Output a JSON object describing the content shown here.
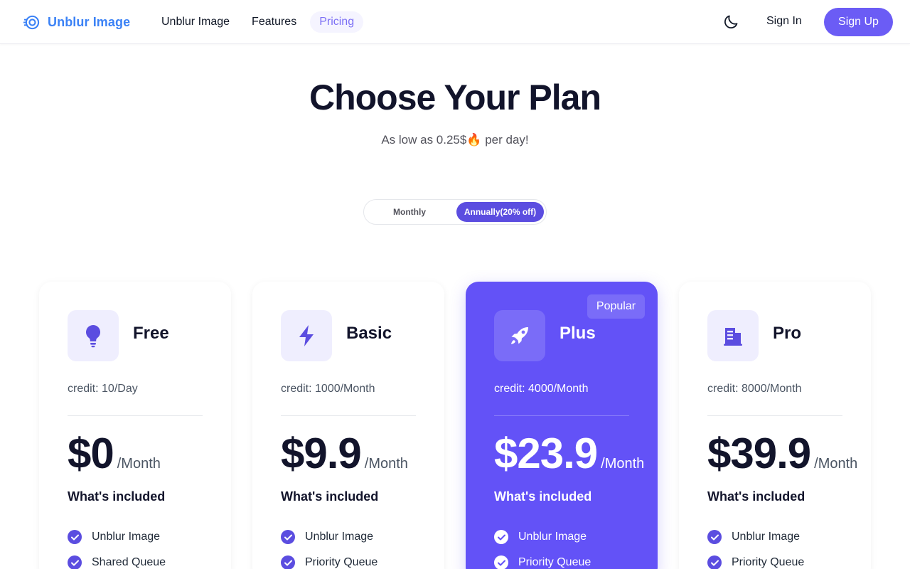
{
  "header": {
    "logo_text": "Unblur Image",
    "nav": [
      {
        "label": "Unblur Image"
      },
      {
        "label": "Features"
      },
      {
        "label": "Pricing",
        "active": true
      }
    ],
    "theme_icon": "moon-icon",
    "signin_label": "Sign In",
    "signup_label": "Sign Up"
  },
  "hero": {
    "title": "Choose Your Plan",
    "subtitle": "As low as 0.25$🔥 per day!"
  },
  "billing_toggle": {
    "monthly_label": "Monthly",
    "annual_label": "Annually(20% off)",
    "selected": "annual"
  },
  "plans": [
    {
      "name": "Free",
      "icon": "lightbulb-icon",
      "credit": "credit: 10/Day",
      "price": "$0",
      "period": "/Month",
      "included_label": "What's included",
      "features": [
        "Unblur Image",
        "Shared Queue"
      ]
    },
    {
      "name": "Basic",
      "icon": "lightning-icon",
      "credit": "credit: 1000/Month",
      "price": "$9.9",
      "period": "/Month",
      "included_label": "What's included",
      "features": [
        "Unblur Image",
        "Priority Queue"
      ]
    },
    {
      "name": "Plus",
      "icon": "rocket-icon",
      "badge": "Popular",
      "credit": "credit: 4000/Month",
      "price": "$23.9",
      "period": "/Month",
      "included_label": "What's included",
      "features": [
        "Unblur Image",
        "Priority Queue"
      ]
    },
    {
      "name": "Pro",
      "icon": "building-icon",
      "credit": "credit: 8000/Month",
      "price": "$39.9",
      "period": "/Month",
      "included_label": "What's included",
      "features": [
        "Unblur Image",
        "Priority Queue"
      ]
    }
  ],
  "colors": {
    "accent": "#6b5cf5",
    "highlight_card": "#6352f7",
    "logo": "#3b82f6",
    "title": "#12142b"
  }
}
